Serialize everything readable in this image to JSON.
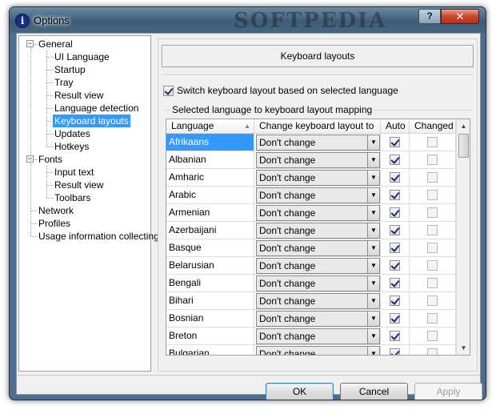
{
  "window": {
    "title": "Options",
    "watermark": "SOFTPEDIA",
    "help_label": "?",
    "close_label": "✕"
  },
  "tree": {
    "items": [
      {
        "label": "General",
        "level": 0,
        "expander": "−"
      },
      {
        "label": "UI Language",
        "level": 1
      },
      {
        "label": "Startup",
        "level": 1
      },
      {
        "label": "Tray",
        "level": 1
      },
      {
        "label": "Result view",
        "level": 1
      },
      {
        "label": "Language detection",
        "level": 1
      },
      {
        "label": "Keyboard layouts",
        "level": 1,
        "selected": true
      },
      {
        "label": "Updates",
        "level": 1
      },
      {
        "label": "Hotkeys",
        "level": 1
      },
      {
        "label": "Fonts",
        "level": 0,
        "expander": "−"
      },
      {
        "label": "Input text",
        "level": 1
      },
      {
        "label": "Result view",
        "level": 1
      },
      {
        "label": "Toolbars",
        "level": 1
      },
      {
        "label": "Network",
        "level": 0
      },
      {
        "label": "Profiles",
        "level": 0
      },
      {
        "label": "Usage information collecting",
        "level": 0
      }
    ]
  },
  "panel": {
    "header": "Keyboard layouts",
    "switch_label": "Switch keyboard layout based on selected language",
    "switch_checked": true,
    "group_label": "Selected language to keyboard layout mapping"
  },
  "grid": {
    "columns": [
      "Language",
      "Change keyboard layout to",
      "Auto",
      "Changed"
    ],
    "rows": [
      {
        "language": "Afrikaans",
        "layout": "Don't change",
        "auto": true,
        "changed": false,
        "selected": true
      },
      {
        "language": "Albanian",
        "layout": "Don't change",
        "auto": true,
        "changed": false
      },
      {
        "language": "Amharic",
        "layout": "Don't change",
        "auto": true,
        "changed": false
      },
      {
        "language": "Arabic",
        "layout": "Don't change",
        "auto": true,
        "changed": false
      },
      {
        "language": "Armenian",
        "layout": "Don't change",
        "auto": true,
        "changed": false
      },
      {
        "language": "Azerbaijani",
        "layout": "Don't change",
        "auto": true,
        "changed": false
      },
      {
        "language": "Basque",
        "layout": "Don't change",
        "auto": true,
        "changed": false
      },
      {
        "language": "Belarusian",
        "layout": "Don't change",
        "auto": true,
        "changed": false
      },
      {
        "language": "Bengali",
        "layout": "Don't change",
        "auto": true,
        "changed": false
      },
      {
        "language": "Bihari",
        "layout": "Don't change",
        "auto": true,
        "changed": false
      },
      {
        "language": "Bosnian",
        "layout": "Don't change",
        "auto": true,
        "changed": false
      },
      {
        "language": "Breton",
        "layout": "Don't change",
        "auto": true,
        "changed": false
      },
      {
        "language": "Bulgarian",
        "layout": "Don't change",
        "auto": true,
        "changed": false
      }
    ]
  },
  "buttons": {
    "ok": "OK",
    "cancel": "Cancel",
    "apply": "Apply"
  },
  "icons": {
    "app": "options-app-icon",
    "combo_arrow": "chevron-down-icon"
  }
}
